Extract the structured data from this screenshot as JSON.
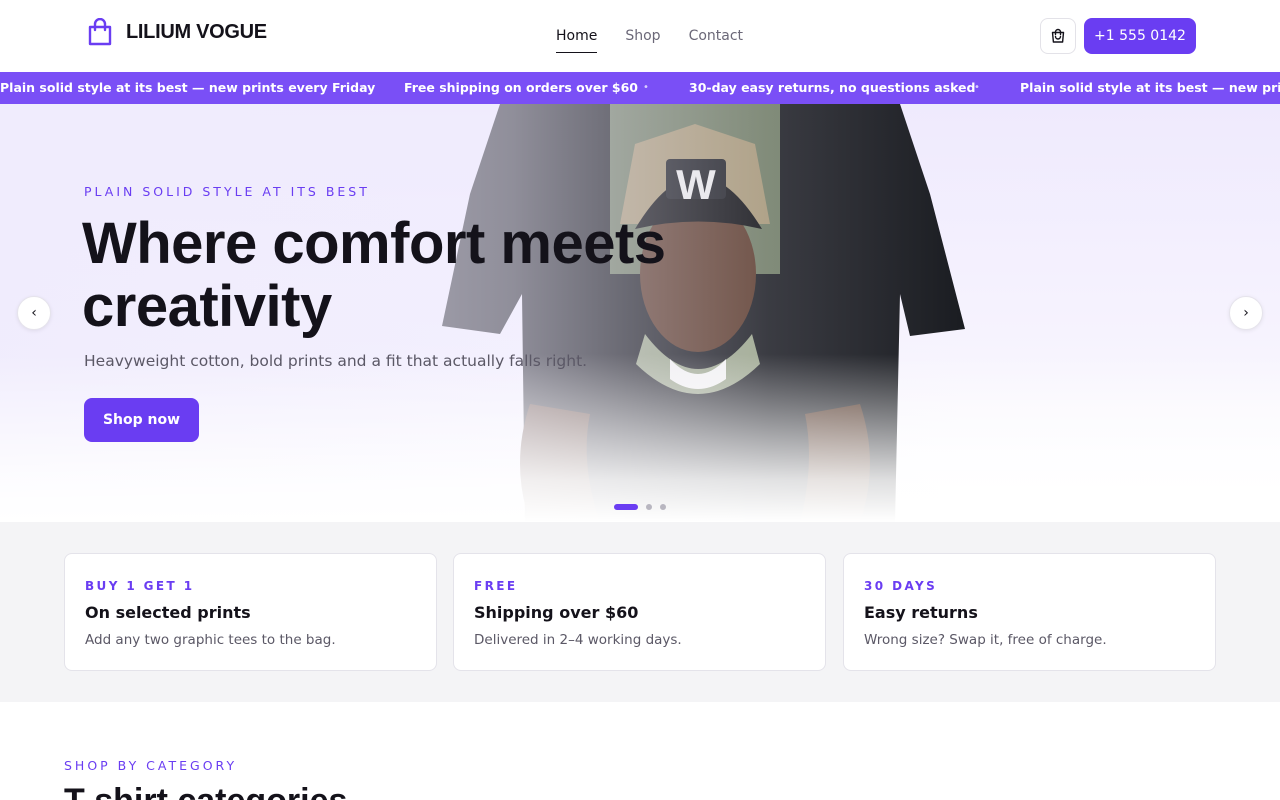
{
  "brand": {
    "name": "LILIUM VOGUE",
    "icon": "shopping-bag-icon",
    "color": "#6a3df2"
  },
  "nav": {
    "links": [
      {
        "label": "Home",
        "active": true
      },
      {
        "label": "Shop",
        "active": false
      },
      {
        "label": "Contact",
        "active": false
      }
    ]
  },
  "header": {
    "cart_icon": "cart-icon",
    "phone_label": "+1 555 0142"
  },
  "ticker": {
    "items": [
      "Plain solid style at its best — new prints every Friday",
      "Free shipping on orders over $60",
      "30-day easy returns, no questions asked",
      "Plain solid style at its best — new prints every Friday"
    ],
    "separator": "•",
    "background": "#7a4ff6"
  },
  "hero": {
    "kicker": "PLAIN SOLID STYLE AT ITS BEST",
    "title": "Where comfort meets creativity",
    "subtitle": "Heavyweight cotton, bold prints and a fit that actually falls right.",
    "cta_label": "Shop now",
    "prev_label": "‹",
    "next_label": "›",
    "slide_count": 3,
    "active_slide": 1
  },
  "features": [
    {
      "kicker": "BUY 1 GET 1",
      "title": "On selected prints",
      "desc": "Add any two graphic tees to the bag."
    },
    {
      "kicker": "FREE",
      "title": "Shipping over $60",
      "desc": "Delivered in 2–4 working days."
    },
    {
      "kicker": "30 DAYS",
      "title": "Easy returns",
      "desc": "Wrong size? Swap it, free of charge."
    }
  ],
  "category": {
    "kicker": "SHOP BY CATEGORY",
    "title": "T-shirt categories"
  }
}
